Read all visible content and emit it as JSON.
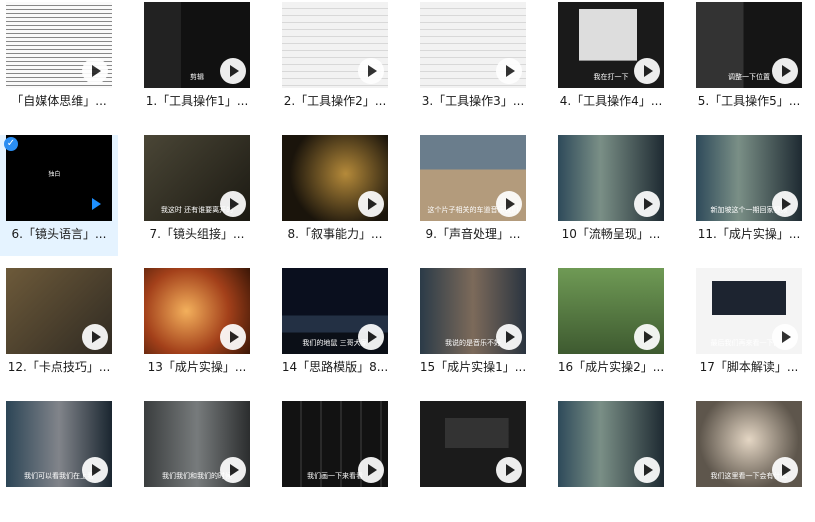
{
  "tiles": [
    {
      "caption": "「自媒体思维」...",
      "theme": "doc",
      "selected": false
    },
    {
      "caption": "1.「工具操作1」...",
      "theme": "dark-ui",
      "selected": false,
      "overlay": "剪辑"
    },
    {
      "caption": "2.「工具操作2」...",
      "theme": "light-ui",
      "selected": false
    },
    {
      "caption": "3.「工具操作3」...",
      "theme": "light-ui",
      "selected": false
    },
    {
      "caption": "4.「工具操作4」...",
      "theme": "menu",
      "selected": false,
      "overlay": "我在打一下"
    },
    {
      "caption": "5.「工具操作5」...",
      "theme": "dark-ui2",
      "selected": false,
      "overlay": "调整一下位置"
    },
    {
      "caption": "6.「镜头语言」...",
      "theme": "black",
      "selected": true,
      "overlay": "独白"
    },
    {
      "caption": "7.「镜头组接」...",
      "theme": "film",
      "selected": false,
      "overlay": "我这时 还有谁要离开的"
    },
    {
      "caption": "8.「叙事能力」...",
      "theme": "night",
      "selected": false
    },
    {
      "caption": "9.「声音处理」...",
      "theme": "desert",
      "selected": false,
      "overlay": "这个片子相关的车道音乐我们"
    },
    {
      "caption": "10「流畅呈现」...",
      "theme": "studio",
      "selected": false
    },
    {
      "caption": "11.「成片实操」...",
      "theme": "studio",
      "selected": false,
      "overlay": "新加坡这个一期回家视频"
    },
    {
      "caption": "12.「卡点技巧」...",
      "theme": "kid",
      "selected": false
    },
    {
      "caption": "13「成片实操」...",
      "theme": "fire",
      "selected": false
    },
    {
      "caption": "14「思路模版」8...",
      "theme": "city",
      "selected": false,
      "overlay": "我们的地鼠 三哥大家"
    },
    {
      "caption": "15「成片实操1」...",
      "theme": "studio2",
      "selected": false,
      "overlay": "我说的是音乐不好"
    },
    {
      "caption": "16「成片实操2」...",
      "theme": "green",
      "selected": false
    },
    {
      "caption": "17「脚本解读」...",
      "theme": "slide",
      "selected": false,
      "overlay": "最后我们再来看一下图片"
    },
    {
      "caption": "",
      "theme": "studio3",
      "selected": false,
      "overlay": "我们可以看我们在上看"
    },
    {
      "caption": "",
      "theme": "office",
      "selected": false,
      "overlay": "我们我们和我们的时候"
    },
    {
      "caption": "",
      "theme": "grid-dark",
      "selected": false,
      "overlay": "我们画一下来看看"
    },
    {
      "caption": "",
      "theme": "editor",
      "selected": false
    },
    {
      "caption": "",
      "theme": "studio",
      "selected": false
    },
    {
      "caption": "",
      "theme": "dog",
      "selected": false,
      "overlay": "我们这里看一下会有什么"
    }
  ]
}
